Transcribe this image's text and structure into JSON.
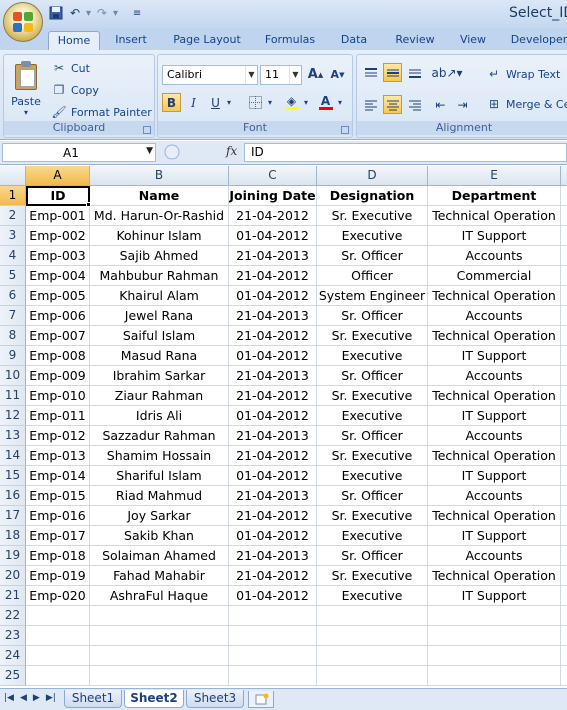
{
  "window": {
    "title": "Select_ID"
  },
  "quick_access": [
    {
      "name": "save-icon",
      "glyph": "💾"
    },
    {
      "name": "undo-icon",
      "glyph": "↶"
    },
    {
      "name": "undo-dropdown-icon",
      "glyph": "▾"
    },
    {
      "name": "redo-icon",
      "glyph": "↷"
    },
    {
      "name": "redo-dropdown-icon",
      "glyph": "▾"
    },
    {
      "name": "customize-qat-icon",
      "glyph": "≡"
    }
  ],
  "tabs": [
    "Home",
    "Insert",
    "Page Layout",
    "Formulas",
    "Data",
    "Review",
    "View",
    "Developer"
  ],
  "active_tab": "Home",
  "ribbon": {
    "clipboard": {
      "label": "Clipboard",
      "paste": "Paste",
      "cut": "Cut",
      "copy": "Copy",
      "format_painter": "Format Painter"
    },
    "font": {
      "label": "Font",
      "font_name": "Calibri",
      "font_size": "11",
      "bold": "B",
      "italic": "I",
      "underline": "U",
      "grow": "A",
      "shrink": "A",
      "font_color_glyph": "A",
      "fill_color": "#ffff00",
      "text_color": "#ff0000"
    },
    "alignment": {
      "label": "Alignment",
      "wrap_text": "Wrap Text",
      "merge_center": "Merge & Center"
    }
  },
  "formula_bar": {
    "name_box": "A1",
    "fx": "fx",
    "content": "ID"
  },
  "sheet": {
    "columns": [
      "A",
      "B",
      "C",
      "D",
      "E"
    ],
    "rows": [
      [
        "ID",
        "Name",
        "Joining Date",
        "Designation",
        "Department"
      ],
      [
        "Emp-001",
        "Md. Harun-Or-Rashid",
        "21-04-2012",
        "Sr. Executive",
        "Technical Operation"
      ],
      [
        "Emp-002",
        "Kohinur Islam",
        "01-04-2012",
        "Executive",
        "IT Support"
      ],
      [
        "Emp-003",
        "Sajib Ahmed",
        "21-04-2013",
        "Sr. Officer",
        "Accounts"
      ],
      [
        "Emp-004",
        "Mahbubur Rahman",
        "21-04-2012",
        "Officer",
        "Commercial"
      ],
      [
        "Emp-005",
        "Khairul Alam",
        "01-04-2012",
        "System Engineer",
        "Technical Operation"
      ],
      [
        "Emp-006",
        "Jewel Rana",
        "21-04-2013",
        "Sr. Officer",
        "Accounts"
      ],
      [
        "Emp-007",
        "Saiful Islam",
        "21-04-2012",
        "Sr. Executive",
        "Technical Operation"
      ],
      [
        "Emp-008",
        "Masud Rana",
        "01-04-2012",
        "Executive",
        "IT Support"
      ],
      [
        "Emp-009",
        "Ibrahim Sarkar",
        "21-04-2013",
        "Sr. Officer",
        "Accounts"
      ],
      [
        "Emp-010",
        "Ziaur Rahman",
        "21-04-2012",
        "Sr. Executive",
        "Technical Operation"
      ],
      [
        "Emp-011",
        "Idris Ali",
        "01-04-2012",
        "Executive",
        "IT Support"
      ],
      [
        "Emp-012",
        "Sazzadur Rahman",
        "21-04-2013",
        "Sr. Officer",
        "Accounts"
      ],
      [
        "Emp-013",
        "Shamim Hossain",
        "21-04-2012",
        "Sr. Executive",
        "Technical Operation"
      ],
      [
        "Emp-014",
        "Shariful Islam",
        "01-04-2012",
        "Executive",
        "IT Support"
      ],
      [
        "Emp-015",
        "Riad Mahmud",
        "21-04-2013",
        "Sr. Officer",
        "Accounts"
      ],
      [
        "Emp-016",
        "Joy Sarkar",
        "21-04-2012",
        "Sr. Executive",
        "Technical Operation"
      ],
      [
        "Emp-017",
        "Sakib Khan",
        "01-04-2012",
        "Executive",
        "IT Support"
      ],
      [
        "Emp-018",
        "Solaiman Ahamed",
        "21-04-2013",
        "Sr. Officer",
        "Accounts"
      ],
      [
        "Emp-019",
        "Fahad Mahabir",
        "21-04-2012",
        "Sr. Executive",
        "Technical Operation"
      ],
      [
        "Emp-020",
        "AshraFul Haque",
        "01-04-2012",
        "Executive",
        "IT Support"
      ]
    ],
    "empty_rows": [
      "22",
      "23",
      "24",
      "25"
    ],
    "selected_cell": "A1"
  },
  "sheet_tabs": [
    "Sheet1",
    "Sheet2",
    "Sheet3"
  ],
  "active_sheet": "Sheet2"
}
